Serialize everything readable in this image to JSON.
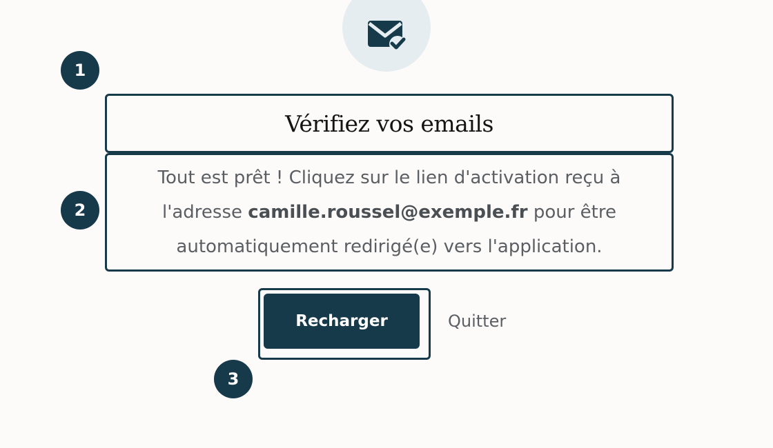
{
  "icon": {
    "name": "mail-check-icon"
  },
  "markers": [
    "1",
    "2",
    "3"
  ],
  "heading": "Vérifiez vos emails",
  "description": {
    "before": "Tout est prêt ! Cliquez sur le lien d'activation reçu à l'adresse ",
    "email": "camille.roussel@exemple.fr",
    "after": " pour être automatiquement redirigé(e) vers l'application."
  },
  "actions": {
    "reload_label": "Recharger",
    "quit_label": "Quitter"
  },
  "colors": {
    "primary": "#173a4b",
    "background": "#fcfbfa",
    "icon_bg": "#e6edf0",
    "muted_text": "#5b5f63"
  }
}
